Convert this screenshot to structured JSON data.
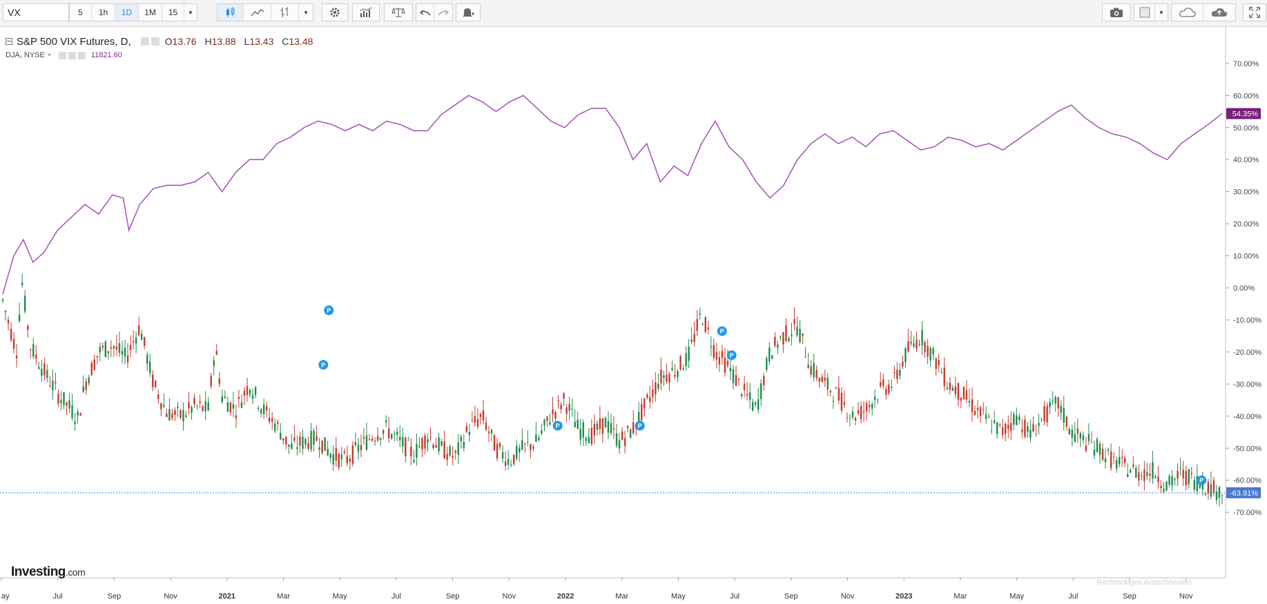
{
  "toolbar": {
    "symbol": "VX",
    "intervals": [
      "5",
      "1h",
      "1D",
      "1M",
      "15"
    ],
    "active_interval": "1D"
  },
  "legend": {
    "main_title": "S&P 500 VIX Futures, D,",
    "ohlc": [
      {
        "k": "O",
        "v": "13.76"
      },
      {
        "k": "H",
        "v": "13.88"
      },
      {
        "k": "L",
        "v": "13.43"
      },
      {
        "k": "C",
        "v": "13.48"
      }
    ],
    "secondary": "DJA, NYSE",
    "secondary_value": "11821.60"
  },
  "branding": {
    "logo": "Investing",
    "logo_suffix": ".com"
  },
  "ghost_text": "Rechteckiges Ausschneiden",
  "colors": {
    "up": "#1f8a4c",
    "down": "#c23a2b",
    "compare": "#a65bb8",
    "accent": "#2f8bd6"
  },
  "chart_data": {
    "type": "line",
    "x_ticks": [
      "ay",
      "Jul",
      "Sep",
      "Nov",
      "2021",
      "Mar",
      "May",
      "Jul",
      "Sep",
      "Nov",
      "2022",
      "Mar",
      "May",
      "Jul",
      "Sep",
      "Nov",
      "2023",
      "Mar",
      "May",
      "Jul",
      "Sep",
      "Nov"
    ],
    "y_ticks": [
      "70.00%",
      "60.00%",
      "50.00%",
      "40.00%",
      "30.00%",
      "20.00%",
      "10.00%",
      "0.00%",
      "-10.00%",
      "-20.00%",
      "-30.00%",
      "-40.00%",
      "-50.00%",
      "-60.00%",
      "-70.00%"
    ],
    "ylim": [
      -72,
      75
    ],
    "series": [
      {
        "name": "DJA, NYSE",
        "current_label": "54.35%",
        "points": [
          [
            0,
            -2
          ],
          [
            0.8,
            10
          ],
          [
            1.5,
            15
          ],
          [
            2.2,
            8
          ],
          [
            3,
            11
          ],
          [
            4,
            18
          ],
          [
            5,
            22
          ],
          [
            6,
            26
          ],
          [
            7,
            23
          ],
          [
            8,
            29
          ],
          [
            8.8,
            28
          ],
          [
            9.2,
            18
          ],
          [
            10,
            26
          ],
          [
            11,
            31
          ],
          [
            12,
            32
          ],
          [
            13,
            32
          ],
          [
            14,
            33
          ],
          [
            15,
            36
          ],
          [
            16,
            30
          ],
          [
            17,
            36
          ],
          [
            18,
            40
          ],
          [
            19,
            40
          ],
          [
            20,
            45
          ],
          [
            21,
            47
          ],
          [
            22,
            50
          ],
          [
            23,
            52
          ],
          [
            24,
            51
          ],
          [
            25,
            49
          ],
          [
            26,
            51
          ],
          [
            27,
            49
          ],
          [
            28,
            52
          ],
          [
            29,
            51
          ],
          [
            30,
            49
          ],
          [
            31,
            49
          ],
          [
            32,
            54
          ],
          [
            33,
            57
          ],
          [
            34,
            60
          ],
          [
            35,
            58
          ],
          [
            36,
            55
          ],
          [
            37,
            58
          ],
          [
            38,
            60
          ],
          [
            39,
            56
          ],
          [
            40,
            52
          ],
          [
            41,
            50
          ],
          [
            42,
            54
          ],
          [
            43,
            56
          ],
          [
            44,
            56
          ],
          [
            45,
            50
          ],
          [
            46,
            40
          ],
          [
            47,
            45
          ],
          [
            48,
            33
          ],
          [
            49,
            38
          ],
          [
            50,
            35
          ],
          [
            51,
            45
          ],
          [
            52,
            52
          ],
          [
            53,
            44
          ],
          [
            54,
            40
          ],
          [
            55,
            33
          ],
          [
            56,
            28
          ],
          [
            57,
            32
          ],
          [
            58,
            40
          ],
          [
            59,
            45
          ],
          [
            60,
            48
          ],
          [
            61,
            45
          ],
          [
            62,
            47
          ],
          [
            63,
            44
          ],
          [
            64,
            48
          ],
          [
            65,
            49
          ],
          [
            66,
            46
          ],
          [
            67,
            43
          ],
          [
            68,
            44
          ],
          [
            69,
            47
          ],
          [
            70,
            46
          ],
          [
            71,
            44
          ],
          [
            72,
            45
          ],
          [
            73,
            43
          ],
          [
            74,
            46
          ],
          [
            75,
            49
          ],
          [
            76,
            52
          ],
          [
            77,
            55
          ],
          [
            78,
            57
          ],
          [
            79,
            53
          ],
          [
            80,
            50
          ],
          [
            81,
            48
          ],
          [
            82,
            47
          ],
          [
            83,
            45
          ],
          [
            84,
            42
          ],
          [
            85,
            40
          ],
          [
            86,
            45
          ],
          [
            87,
            48
          ],
          [
            88,
            51
          ],
          [
            89,
            54.35
          ]
        ]
      },
      {
        "name": "S&P 500 VIX Futures",
        "current_label": "-63.91%",
        "points": [
          [
            0,
            -4
          ],
          [
            1,
            -20
          ],
          [
            1.4,
            2
          ],
          [
            2,
            -18
          ],
          [
            3,
            -26
          ],
          [
            4,
            -33
          ],
          [
            5,
            -38
          ],
          [
            5.5,
            -41
          ],
          [
            6,
            -30
          ],
          [
            7,
            -20
          ],
          [
            8,
            -18
          ],
          [
            9,
            -22
          ],
          [
            10,
            -12
          ],
          [
            11,
            -30
          ],
          [
            12,
            -39
          ],
          [
            13,
            -40
          ],
          [
            14,
            -37
          ],
          [
            15,
            -38
          ],
          [
            15.5,
            -18
          ],
          [
            16,
            -34
          ],
          [
            17,
            -38
          ],
          [
            18,
            -30
          ],
          [
            19,
            -38
          ],
          [
            20,
            -43
          ],
          [
            21,
            -50
          ],
          [
            22,
            -48
          ],
          [
            23,
            -47
          ],
          [
            24,
            -52
          ],
          [
            25,
            -54
          ],
          [
            26,
            -50
          ],
          [
            27,
            -46
          ],
          [
            28,
            -44
          ],
          [
            29,
            -48
          ],
          [
            30,
            -52
          ],
          [
            31,
            -46
          ],
          [
            32,
            -50
          ],
          [
            33,
            -53
          ],
          [
            34,
            -44
          ],
          [
            35,
            -40
          ],
          [
            36,
            -50
          ],
          [
            37,
            -54
          ],
          [
            38,
            -50
          ],
          [
            39,
            -48
          ],
          [
            40,
            -40
          ],
          [
            41,
            -35
          ],
          [
            42,
            -44
          ],
          [
            43,
            -46
          ],
          [
            44,
            -42
          ],
          [
            45,
            -48
          ],
          [
            46,
            -44
          ],
          [
            47,
            -36
          ],
          [
            48,
            -28
          ],
          [
            49,
            -26
          ],
          [
            50,
            -22
          ],
          [
            51,
            -8
          ],
          [
            52,
            -20
          ],
          [
            53,
            -25
          ],
          [
            54,
            -32
          ],
          [
            55,
            -38
          ],
          [
            56,
            -20
          ],
          [
            57,
            -15
          ],
          [
            58,
            -12
          ],
          [
            59,
            -25
          ],
          [
            60,
            -30
          ],
          [
            61,
            -34
          ],
          [
            62,
            -40
          ],
          [
            63,
            -38
          ],
          [
            64,
            -32
          ],
          [
            65,
            -30
          ],
          [
            66,
            -20
          ],
          [
            67,
            -15
          ],
          [
            68,
            -22
          ],
          [
            69,
            -30
          ],
          [
            70,
            -33
          ],
          [
            71,
            -38
          ],
          [
            72,
            -42
          ],
          [
            73,
            -45
          ],
          [
            74,
            -40
          ],
          [
            75,
            -46
          ],
          [
            76,
            -40
          ],
          [
            77,
            -36
          ],
          [
            78,
            -45
          ],
          [
            79,
            -48
          ],
          [
            80,
            -50
          ],
          [
            81,
            -54
          ],
          [
            82,
            -56
          ],
          [
            83,
            -58
          ],
          [
            84,
            -57
          ],
          [
            85,
            -62
          ],
          [
            86,
            -58
          ],
          [
            87,
            -60
          ],
          [
            88,
            -62
          ],
          [
            89,
            -63.91
          ]
        ]
      }
    ]
  }
}
